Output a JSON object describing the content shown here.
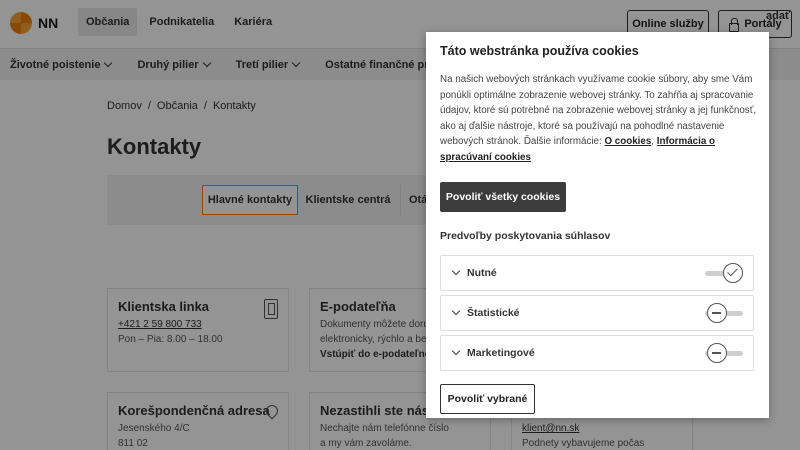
{
  "header": {
    "logo_text": "NN",
    "nav": [
      "Občania",
      "Podnikatelia",
      "Kariéra"
    ],
    "online_label": "Online služby",
    "portaly_label": "Portály"
  },
  "catnav": {
    "items": [
      "Životné poistenie",
      "Druhý pilier",
      "Tretí pilier",
      "Ostatné finančné produkty"
    ],
    "tail": "adať"
  },
  "breadcrumb": [
    "Domov",
    "/",
    "Občania",
    "/",
    "Kontakty"
  ],
  "page_title": "Kontakty",
  "tabs": [
    "Hlavné kontakty",
    "Klientske centrá",
    "Otá"
  ],
  "cards": {
    "linka": {
      "title": "Klientska linka",
      "phone": "+421 2 59 800 733",
      "hours": "Pon – Pia: 8.00 – 18.00"
    },
    "epodatelna": {
      "title": "E-podateľňa",
      "l1": "Dokumenty môžete doru",
      "l2": "elektronicky, rýchlo a be",
      "link": "Vstúpiť do e-podateľne"
    },
    "adresa": {
      "title": "Korešpondenčná adresa",
      "l1": "Jesenského 4/C",
      "l2": "811 02"
    },
    "nezastihli": {
      "title": "Nezastihli ste nás?",
      "l1": "Nechajte nám telefónne číslo",
      "l2": "a my vám zavoláme."
    },
    "email": {
      "l1": "klient@nn.sk",
      "l2": "Podnety vybavujeme počas"
    }
  },
  "cookie": {
    "title": "Táto webstránka používa cookies",
    "text": "Na našich webových stránkach využívame cookie súbory, aby sme Vám ponúkli optimálne zobrazenie webovej stránky. To zahŕňa aj spracovanie údajov, ktoré sú potrebné na zobrazenie webovej stránky a jej funkčnosť, ako aj ďalšie nástroje, ktoré sa používajú na pohodlné nastavenie webových stránok. Ďalšie informácie:",
    "link1": "O cookies",
    "link2": "Informácia o spracúvaní cookies",
    "allow_all": "Povoliť všetky cookies",
    "prefs_title": "Predvoľby poskytovania súhlasov",
    "prefs": [
      {
        "label": "Nutné",
        "state": "on"
      },
      {
        "label": "Štatistické",
        "state": "off"
      },
      {
        "label": "Marketingové",
        "state": "off"
      }
    ],
    "allow_selected": "Povoliť vybrané"
  }
}
